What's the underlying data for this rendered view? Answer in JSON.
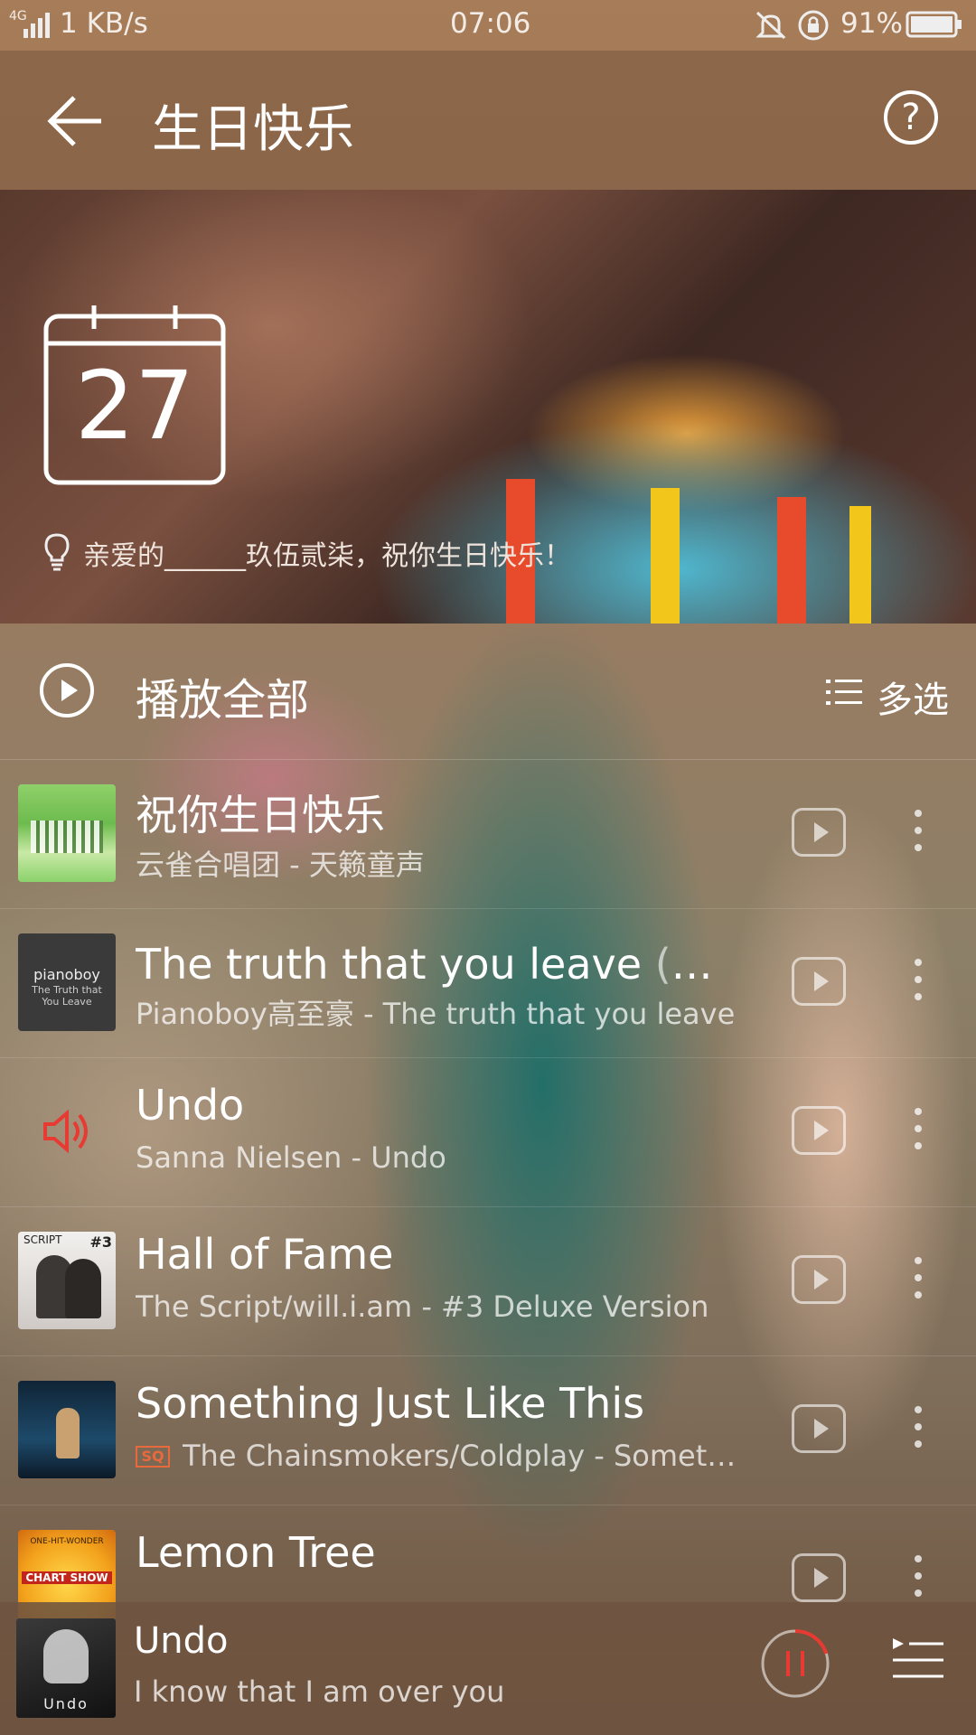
{
  "status_bar": {
    "network": "4G",
    "speed": "1 KB/s",
    "time": "07:06",
    "battery": "91%"
  },
  "header": {
    "title": "生日快乐",
    "help_label": "?"
  },
  "banner": {
    "calendar_day": "27",
    "wish_text": "亲爱的______玖伍贰柒，祝你生日快乐！"
  },
  "toolbar": {
    "play_all_label": "播放全部",
    "multi_select_label": "多选"
  },
  "songs": [
    {
      "title": "祝你生日快乐",
      "subtitle": "云雀合唱团 - 天籁童声"
    },
    {
      "title": "The truth that you leave",
      "title_extra": " (你离开…",
      "subtitle": "Pianoboy高至豪 - The truth that you leave",
      "cover_text_1": "pianoboy",
      "cover_text_2": "The Truth that You Leave"
    },
    {
      "title": "Undo",
      "subtitle": "Sanna Nielsen - Undo",
      "playing": true
    },
    {
      "title": "Hall of Fame",
      "subtitle": "The Script/will.i.am - #3 Deluxe Version",
      "cover_text_1": "SCRIPT",
      "cover_text_2": "#3"
    },
    {
      "title": "Something Just Like This",
      "subtitle": "The Chainsmokers/Coldplay - Something…",
      "quality_badge": "SQ"
    },
    {
      "title": "Lemon Tree",
      "subtitle": "",
      "cover_text_1": "ONE-HIT-WONDER",
      "cover_text_2": "CHART SHOW"
    }
  ],
  "now_playing": {
    "title": "Undo",
    "lyric": "I know that I am over you",
    "progress": 0.2
  },
  "colors": {
    "accent": "#e63a32",
    "quality_badge": "#e86a3c"
  }
}
